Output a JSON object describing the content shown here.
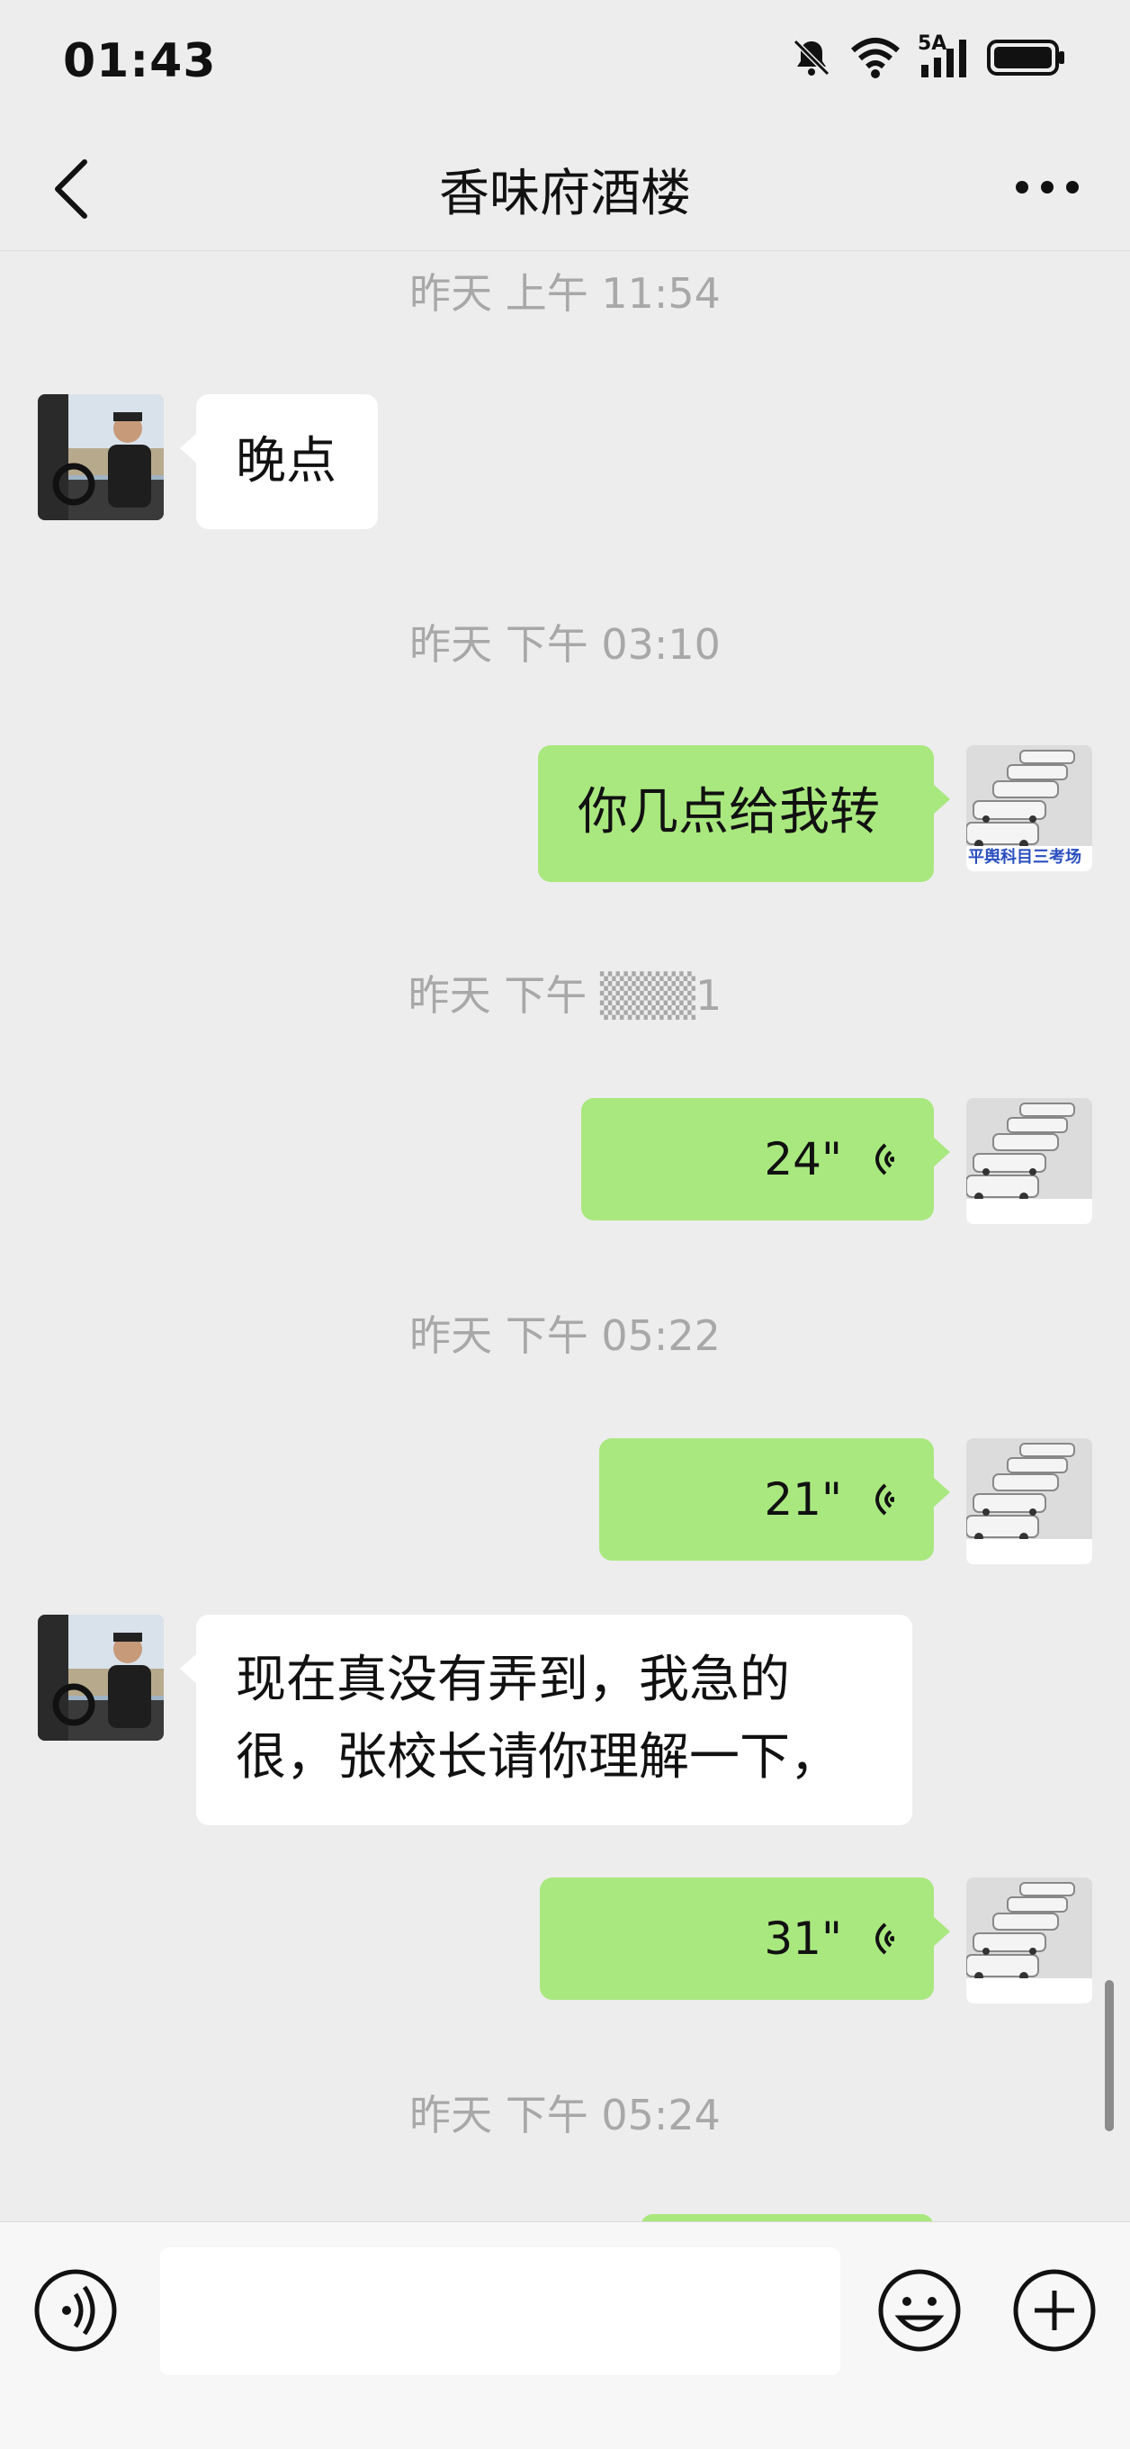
{
  "status_bar": {
    "time": "01:43",
    "network": "5A"
  },
  "header": {
    "title": "香味府酒楼"
  },
  "messages": [
    {
      "timestamp": "昨天 上午 11:54"
    },
    {
      "text": "晚点",
      "side": "in"
    },
    {
      "timestamp": "昨天 下午 03:10"
    },
    {
      "text": "你几点给我转",
      "side": "out"
    },
    {
      "timestamp": "昨天 下午 ▒▒▒1"
    },
    {
      "voice": "24\"",
      "side": "out"
    },
    {
      "timestamp": "昨天 下午 05:22"
    },
    {
      "voice": "21\"",
      "side": "out"
    },
    {
      "text_line1": "现在真没有弄到，我急的",
      "text_line2": "很，张校长请你理解一下，",
      "side": "in"
    },
    {
      "voice": "31\"",
      "side": "out"
    },
    {
      "timestamp": "昨天 下午 05:24"
    }
  ],
  "avatar_caption": "平舆科目三考场",
  "colors": {
    "outgoing_bubble": "#a9e87f",
    "incoming_bubble": "#ffffff",
    "background": "#ededed"
  },
  "icons": [
    "back-icon",
    "more-icon",
    "mute-bell-icon",
    "wifi-icon",
    "signal-icon",
    "battery-icon",
    "voice-mode-icon",
    "emoji-icon",
    "plus-icon"
  ]
}
